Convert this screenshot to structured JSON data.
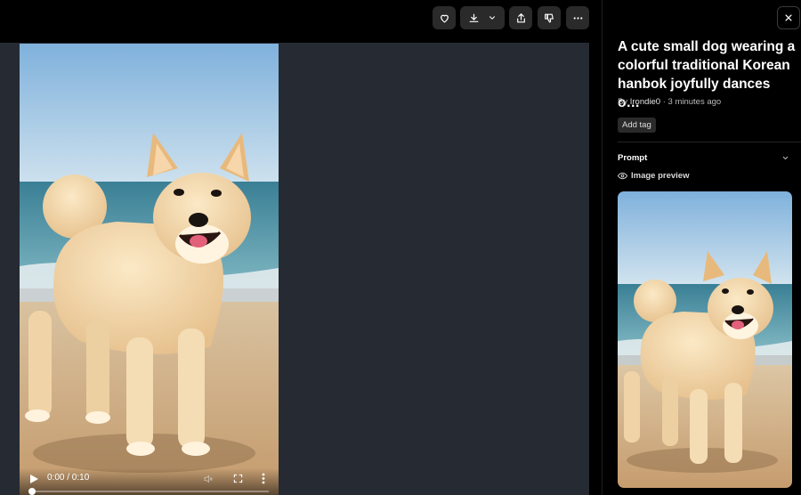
{
  "toolbar": {
    "buttons": [
      {
        "name": "like",
        "icon": "heart-icon"
      },
      {
        "name": "download",
        "icon": "download-icon"
      },
      {
        "name": "share",
        "icon": "share-icon"
      },
      {
        "name": "dislike",
        "icon": "thumbs-down-icon"
      },
      {
        "name": "more",
        "icon": "more-horizontal-icon"
      }
    ]
  },
  "video": {
    "time_display": "0:00 / 0:10",
    "progress": 0.0
  },
  "panel": {
    "title": "A cute small dog wearing a colorful traditional Korean hanbok joyfully dances o…",
    "by_prefix": "By",
    "author": "Irondie0",
    "separator": " · ",
    "time_ago": "3 minutes ago",
    "add_tag_label": "Add tag",
    "prompt_label": "Prompt",
    "image_preview_label": "Image preview"
  },
  "colors": {
    "stage_bg": "#262b33",
    "panel_bg": "#000000",
    "button_bg": "#2a2a2a"
  }
}
